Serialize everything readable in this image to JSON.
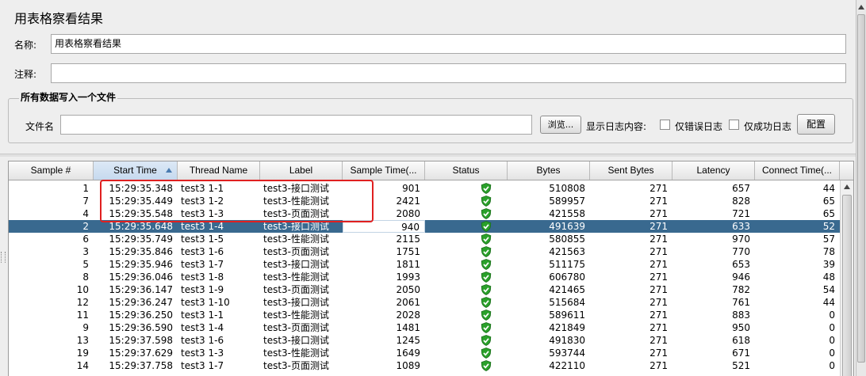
{
  "panel": {
    "title": "用表格察看结果",
    "name_label": "名称:",
    "name_value": "用表格察看结果",
    "comment_label": "注释:",
    "comment_value": ""
  },
  "file_group": {
    "title": "所有数据写入一个文件",
    "filename_label": "文件名",
    "filename_value": "",
    "browse_button": "浏览...",
    "log_content_label": "显示日志内容:",
    "errors_only_label": "仅错误日志",
    "errors_only_checked": false,
    "success_only_label": "仅成功日志",
    "success_only_checked": false,
    "configure_button": "配置"
  },
  "table": {
    "columns": [
      "Sample #",
      "Start Time",
      "Thread Name",
      "Label",
      "Sample Time(...",
      "Status",
      "Bytes",
      "Sent Bytes",
      "Latency",
      "Connect Time(..."
    ],
    "sorted_column": "Start Time",
    "sort_direction": "ascending",
    "selected_row_index": 3,
    "rows": [
      {
        "sample": "1",
        "start": "15:29:35.348",
        "thread": "test3 1-1",
        "label": "test3-接口测试",
        "time": "901",
        "status": "success",
        "bytes": "510808",
        "sent": "271",
        "latency": "657",
        "connect": "44"
      },
      {
        "sample": "7",
        "start": "15:29:35.449",
        "thread": "test3 1-2",
        "label": "test3-性能测试",
        "time": "2421",
        "status": "success",
        "bytes": "589957",
        "sent": "271",
        "latency": "828",
        "connect": "65"
      },
      {
        "sample": "4",
        "start": "15:29:35.548",
        "thread": "test3 1-3",
        "label": "test3-页面测试",
        "time": "2080",
        "status": "success",
        "bytes": "421558",
        "sent": "271",
        "latency": "721",
        "connect": "65"
      },
      {
        "sample": "2",
        "start": "15:29:35.648",
        "thread": "test3 1-4",
        "label": "test3-接口测试",
        "time": "940",
        "status": "success",
        "bytes": "491639",
        "sent": "271",
        "latency": "633",
        "connect": "52"
      },
      {
        "sample": "6",
        "start": "15:29:35.749",
        "thread": "test3 1-5",
        "label": "test3-性能测试",
        "time": "2115",
        "status": "success",
        "bytes": "580855",
        "sent": "271",
        "latency": "970",
        "connect": "57"
      },
      {
        "sample": "3",
        "start": "15:29:35.846",
        "thread": "test3 1-6",
        "label": "test3-页面测试",
        "time": "1751",
        "status": "success",
        "bytes": "421563",
        "sent": "271",
        "latency": "770",
        "connect": "78"
      },
      {
        "sample": "5",
        "start": "15:29:35.946",
        "thread": "test3 1-7",
        "label": "test3-接口测试",
        "time": "1811",
        "status": "success",
        "bytes": "511175",
        "sent": "271",
        "latency": "653",
        "connect": "39"
      },
      {
        "sample": "8",
        "start": "15:29:36.046",
        "thread": "test3 1-8",
        "label": "test3-性能测试",
        "time": "1993",
        "status": "success",
        "bytes": "606780",
        "sent": "271",
        "latency": "946",
        "connect": "48"
      },
      {
        "sample": "10",
        "start": "15:29:36.147",
        "thread": "test3 1-9",
        "label": "test3-页面测试",
        "time": "2050",
        "status": "success",
        "bytes": "421465",
        "sent": "271",
        "latency": "782",
        "connect": "54"
      },
      {
        "sample": "12",
        "start": "15:29:36.247",
        "thread": "test3 1-10",
        "label": "test3-接口测试",
        "time": "2061",
        "status": "success",
        "bytes": "515684",
        "sent": "271",
        "latency": "761",
        "connect": "44"
      },
      {
        "sample": "11",
        "start": "15:29:36.250",
        "thread": "test3 1-1",
        "label": "test3-性能测试",
        "time": "2028",
        "status": "success",
        "bytes": "589611",
        "sent": "271",
        "latency": "883",
        "connect": "0"
      },
      {
        "sample": "9",
        "start": "15:29:36.590",
        "thread": "test3 1-4",
        "label": "test3-页面测试",
        "time": "1481",
        "status": "success",
        "bytes": "421849",
        "sent": "271",
        "latency": "950",
        "connect": "0"
      },
      {
        "sample": "13",
        "start": "15:29:37.598",
        "thread": "test3 1-6",
        "label": "test3-接口测试",
        "time": "1245",
        "status": "success",
        "bytes": "491830",
        "sent": "271",
        "latency": "618",
        "connect": "0"
      },
      {
        "sample": "19",
        "start": "15:29:37.629",
        "thread": "test3 1-3",
        "label": "test3-性能测试",
        "time": "1649",
        "status": "success",
        "bytes": "593744",
        "sent": "271",
        "latency": "671",
        "connect": "0"
      },
      {
        "sample": "14",
        "start": "15:29:37.758",
        "thread": "test3 1-7",
        "label": "test3-页面测试",
        "time": "1089",
        "status": "success",
        "bytes": "422110",
        "sent": "271",
        "latency": "521",
        "connect": "0"
      }
    ]
  },
  "colors": {
    "selection": "#39698f",
    "status_success": "#2aa02a",
    "annotation": "#e02020"
  }
}
